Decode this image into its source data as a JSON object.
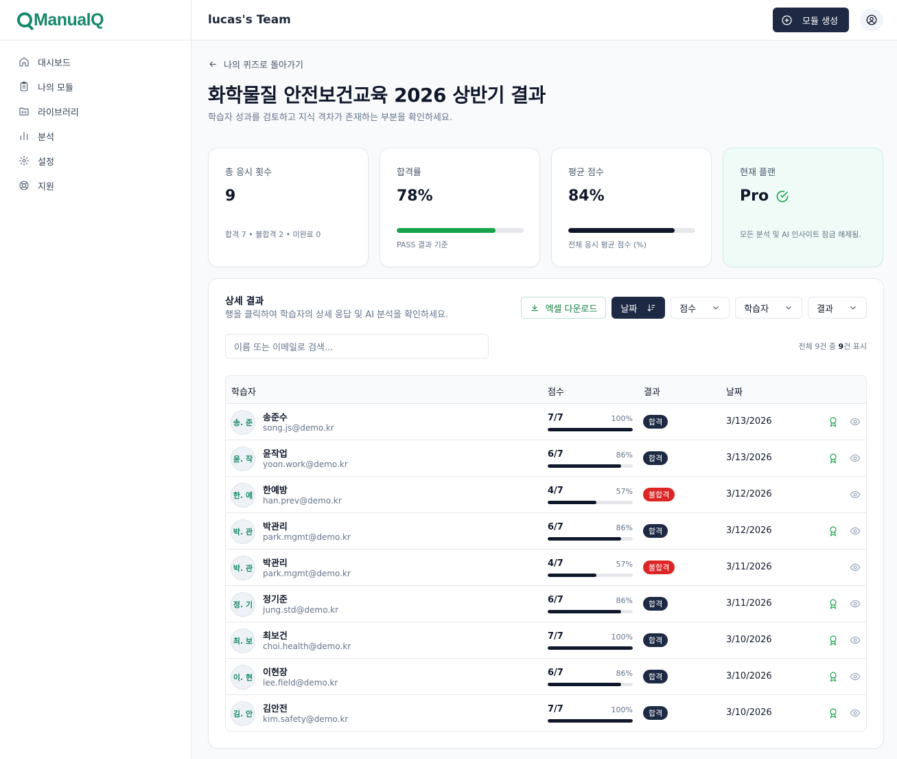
{
  "brand": {
    "logo_text": "ManualQ",
    "accent": "#16896b"
  },
  "sidebar": {
    "items": [
      {
        "label": "대시보드",
        "icon": "home-icon"
      },
      {
        "label": "나의 모듈",
        "icon": "clipboard-icon"
      },
      {
        "label": "라이브러리",
        "icon": "folder-icon"
      },
      {
        "label": "분석",
        "icon": "bar-chart-icon"
      },
      {
        "label": "설정",
        "icon": "gear-icon"
      },
      {
        "label": "지원",
        "icon": "lifebuoy-icon"
      }
    ]
  },
  "header": {
    "team": "lucas's Team",
    "create_label": "모듈 생성"
  },
  "page": {
    "back_label": "나의 퀴즈로 돌아가기",
    "title": "화학물질 안전보건교육 2026 상반기 결과",
    "subtitle": "학습자 성과를 검토하고 지식 격차가 존재하는 부분을 확인하세요."
  },
  "stats": {
    "attempts": {
      "label": "총 응시 횟수",
      "value": "9",
      "foot": "합격 7 • 불합격 2 • 미완료 0"
    },
    "pass_rate": {
      "label": "합격률",
      "value": "78%",
      "progress": 0.78,
      "foot": "PASS 결과 기준",
      "color": "#16a34a"
    },
    "avg_score": {
      "label": "평균 점수",
      "value": "84%",
      "progress": 0.84,
      "foot": "전체 응시 평균 점수 (%)",
      "color": "#0f172a"
    },
    "plan": {
      "label": "현재 플랜",
      "value": "Pro",
      "foot": "모든 분석 및 AI 인사이트 잠금 해제됨."
    }
  },
  "detail": {
    "title": "상세 결과",
    "subtitle": "행을 클릭하여 학습자의 상세 응답 및 AI 분석을 확인하세요.",
    "excel_label": "엑셀 다운로드",
    "sort_date_label": "날짜",
    "filter_score_label": "점수",
    "filter_learner_label": "학습자",
    "filter_result_label": "결과",
    "search_placeholder": "이름 또는 이메일로 검색...",
    "count_prefix": "전체 9건 중 ",
    "count_shown": "9",
    "count_suffix": "건 표시",
    "columns": {
      "learner": "학습자",
      "score": "점수",
      "result": "결과",
      "date": "날짜"
    },
    "rows": [
      {
        "initials": "송. 준",
        "name": "송준수",
        "email": "song.js@demo.kr",
        "score": "7/7",
        "pct": "100%",
        "progress": 1.0,
        "result": "합격",
        "pass": true,
        "date": "3/13/2026"
      },
      {
        "initials": "윤. 작",
        "name": "윤작업",
        "email": "yoon.work@demo.kr",
        "score": "6/7",
        "pct": "86%",
        "progress": 0.86,
        "result": "합격",
        "pass": true,
        "date": "3/13/2026"
      },
      {
        "initials": "한. 예",
        "name": "한예방",
        "email": "han.prev@demo.kr",
        "score": "4/7",
        "pct": "57%",
        "progress": 0.57,
        "result": "불합격",
        "pass": false,
        "date": "3/12/2026"
      },
      {
        "initials": "박. 관",
        "name": "박관리",
        "email": "park.mgmt@demo.kr",
        "score": "6/7",
        "pct": "86%",
        "progress": 0.86,
        "result": "합격",
        "pass": true,
        "date": "3/12/2026"
      },
      {
        "initials": "박. 관",
        "name": "박관리",
        "email": "park.mgmt@demo.kr",
        "score": "4/7",
        "pct": "57%",
        "progress": 0.57,
        "result": "불합격",
        "pass": false,
        "date": "3/11/2026"
      },
      {
        "initials": "정. 기",
        "name": "정기준",
        "email": "jung.std@demo.kr",
        "score": "6/7",
        "pct": "86%",
        "progress": 0.86,
        "result": "합격",
        "pass": true,
        "date": "3/11/2026"
      },
      {
        "initials": "최. 보",
        "name": "최보건",
        "email": "choi.health@demo.kr",
        "score": "7/7",
        "pct": "100%",
        "progress": 1.0,
        "result": "합격",
        "pass": true,
        "date": "3/10/2026"
      },
      {
        "initials": "이. 현",
        "name": "이현장",
        "email": "lee.field@demo.kr",
        "score": "6/7",
        "pct": "86%",
        "progress": 0.86,
        "result": "합격",
        "pass": true,
        "date": "3/10/2026"
      },
      {
        "initials": "김. 안",
        "name": "김안전",
        "email": "kim.safety@demo.kr",
        "score": "7/7",
        "pct": "100%",
        "progress": 1.0,
        "result": "합격",
        "pass": true,
        "date": "3/10/2026"
      }
    ]
  }
}
